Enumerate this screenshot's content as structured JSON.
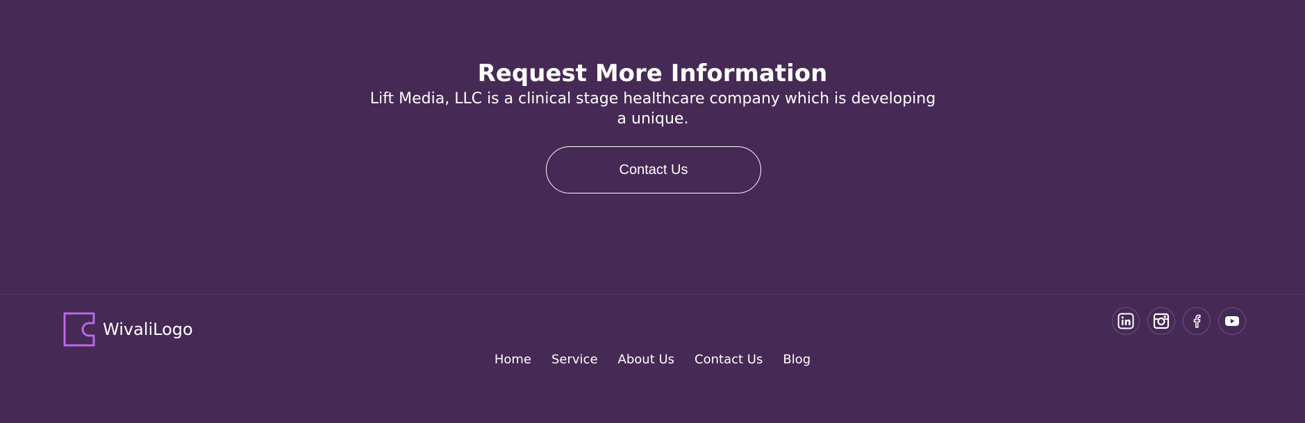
{
  "cta": {
    "title": "Request More Information",
    "subtitle": "Lift Media, LLC is a clinical stage healthcare company which is developing a unique.",
    "button_label": "Contact Us"
  },
  "footer": {
    "logo_text": "WivaliLogo",
    "nav": [
      "Home",
      "Service",
      "About Us",
      "Contact Us",
      "Blog"
    ],
    "social": [
      {
        "icon": "linkedin-icon"
      },
      {
        "icon": "instagram-icon"
      },
      {
        "icon": "facebook-icon"
      },
      {
        "icon": "youtube-icon"
      }
    ]
  },
  "colors": {
    "background": "#462955",
    "logo_accent": "#b86ae8",
    "text": "#ffffff"
  }
}
